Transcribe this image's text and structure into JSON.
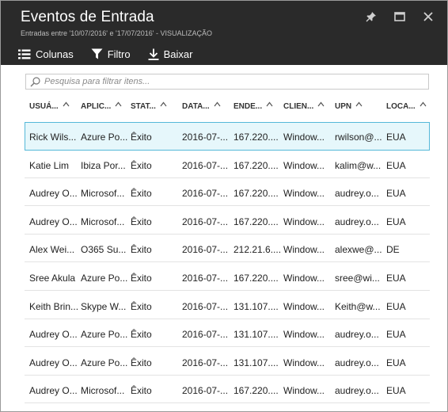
{
  "header": {
    "title": "Eventos de Entrada",
    "subtitle": "Entradas entre '10/07/2016' e '17/07/2016' - VISUALIZAÇÃO"
  },
  "toolbar": {
    "columns_label": "Colunas",
    "filter_label": "Filtro",
    "download_label": "Baixar"
  },
  "search": {
    "placeholder": "Pesquisa para filtrar itens..."
  },
  "columns": [
    "USUÁ...",
    "APLIC...",
    "STAT...",
    "DATA...",
    "ENDE...",
    "CLIEN...",
    "UPN",
    "LOCA..."
  ],
  "rows": [
    [
      "Rick Wils...",
      "Azure Po...",
      "Êxito",
      "2016-07-...",
      "167.220....",
      "Window...",
      "rwilson@...",
      "EUA"
    ],
    [
      "Katie Lim",
      "Ibiza Por...",
      "Êxito",
      "2016-07-...",
      "167.220....",
      "Window...",
      "kalim@w...",
      "EUA"
    ],
    [
      "Audrey O...",
      "Microsof...",
      "Êxito",
      "2016-07-...",
      "167.220....",
      "Window...",
      "audrey.o...",
      "EUA"
    ],
    [
      "Audrey O...",
      "Microsof...",
      "Êxito",
      "2016-07-...",
      "167.220....",
      "Window...",
      "audrey.o...",
      "EUA"
    ],
    [
      "Alex Wei...",
      "O365 Su...",
      "Êxito",
      "2016-07-...",
      "212.21.6....",
      "Window...",
      "alexwe@...",
      "DE"
    ],
    [
      "Sree Akula",
      "Azure Po...",
      "Êxito",
      "2016-07-...",
      "167.220....",
      "Window...",
      "sree@wi...",
      "EUA"
    ],
    [
      "Keith Brin...",
      "Skype W...",
      "Êxito",
      "2016-07-...",
      "131.107....",
      "Window...",
      "Keith@w...",
      "EUA"
    ],
    [
      "Audrey O...",
      "Azure Po...",
      "Êxito",
      "2016-07-...",
      "131.107....",
      "Window...",
      "audrey.o...",
      "EUA"
    ],
    [
      "Audrey O...",
      "Azure Po...",
      "Êxito",
      "2016-07-...",
      "131.107....",
      "Window...",
      "audrey.o...",
      "EUA"
    ],
    [
      "Audrey O...",
      "Microsof...",
      "Êxito",
      "2016-07-...",
      "167.220....",
      "Window...",
      "audrey.o...",
      "EUA"
    ]
  ],
  "selected_row": 0,
  "colors": {
    "header_bg": "#2a2a2a",
    "selected_bg": "#e6f7fb",
    "selected_border": "#55b8d8"
  }
}
